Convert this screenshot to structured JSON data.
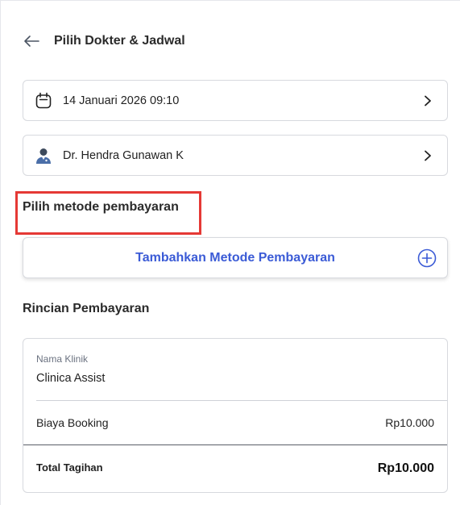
{
  "header": {
    "title": "Pilih Dokter & Jadwal",
    "back_icon": "arrow-left-icon"
  },
  "schedule": {
    "value": "14 Januari 2026 09:10",
    "icon": "calendar-icon"
  },
  "doctor": {
    "value": "Dr. Hendra Gunawan K",
    "icon": "doctor-avatar-icon"
  },
  "payment_method": {
    "section_title": "Pilih metode pembayaran",
    "add_label": "Tambahkan Metode Pembayaran",
    "add_icon": "plus-circle-icon",
    "accent_color": "#3b5bd6"
  },
  "highlight": {
    "color": "#e53935"
  },
  "details": {
    "section_title": "Rincian Pembayaran",
    "clinic_caption": "Nama Klinik",
    "clinic_name": "Clinica Assist",
    "booking_label": "Biaya Booking",
    "booking_value": "Rp10.000",
    "total_label": "Total Tagihan",
    "total_value": "Rp10.000"
  }
}
